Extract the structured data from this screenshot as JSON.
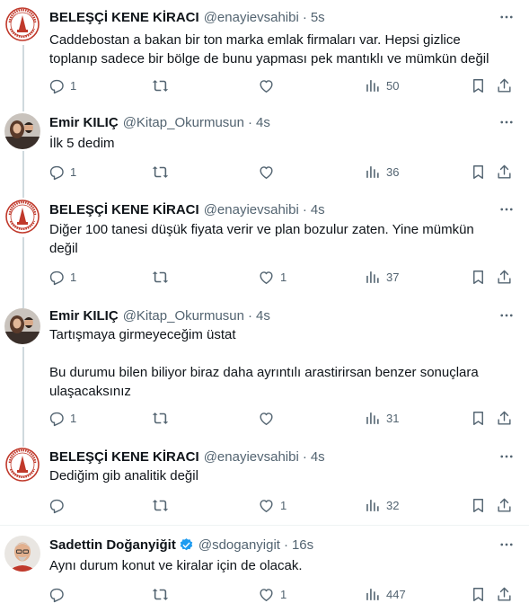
{
  "tweets": [
    {
      "name": "BELEŞÇİ KENE KİRACI",
      "handle": "@enayievsahibi",
      "time": "5s",
      "text": "Caddebostan a bakan bir ton marka emlak firmaları var. Hepsi gizlice\ntoplanıp sadece bir bölge de bunu yapması pek mantıklı ve mümkün değil",
      "replies": "1",
      "retweets": "",
      "likes": "",
      "views": "50",
      "avatar": "seal-logo"
    },
    {
      "name": "Emir KILIÇ",
      "handle": "@Kitap_Okurmusun",
      "time": "4s",
      "text": "İlk 5 dedim",
      "replies": "1",
      "retweets": "",
      "likes": "",
      "views": "36",
      "avatar": "couple-photo"
    },
    {
      "name": "BELEŞÇİ KENE KİRACI",
      "handle": "@enayievsahibi",
      "time": "4s",
      "text": "Diğer 100 tanesi düşük fiyata verir ve plan bozulur zaten. Yine mümkün\ndeğil",
      "replies": "1",
      "retweets": "",
      "likes": "1",
      "views": "37",
      "avatar": "seal-logo"
    },
    {
      "name": "Emir KILIÇ",
      "handle": "@Kitap_Okurmusun",
      "time": "4s",
      "text": "Tartışmaya girmeyeceğim üstat\n\nBu durumu bilen biliyor biraz daha ayrıntılı arastirirsan benzer sonuçlara\nulaşacaksınız",
      "replies": "1",
      "retweets": "",
      "likes": "",
      "views": "31",
      "avatar": "couple-photo"
    },
    {
      "name": "BELEŞÇİ KENE KİRACI",
      "handle": "@enayievsahibi",
      "time": "4s",
      "text": "Dediğim gib analitik değil",
      "replies": "",
      "retweets": "",
      "likes": "1",
      "views": "32",
      "avatar": "seal-logo"
    },
    {
      "name": "Sadettin Doğanyiğit",
      "handle": "@sdoganyigit",
      "time": "16s",
      "text": "Aynı durum konut ve kiralar için de olacak.",
      "replies": "",
      "retweets": "",
      "likes": "1",
      "views": "447",
      "verified": true,
      "avatar": "man-photo"
    }
  ],
  "icons": {
    "reply": "reply-icon",
    "retweet": "retweet-icon",
    "like": "heart-icon",
    "views": "views-icon",
    "bookmark": "bookmark-icon",
    "share": "share-icon",
    "more": "more-icon",
    "verified": "verified-badge-icon"
  },
  "colors": {
    "text": "#0f1419",
    "muted": "#536471",
    "divider": "#eff3f4",
    "thread_line": "#cfd9de",
    "verified": "#1d9bf0"
  }
}
